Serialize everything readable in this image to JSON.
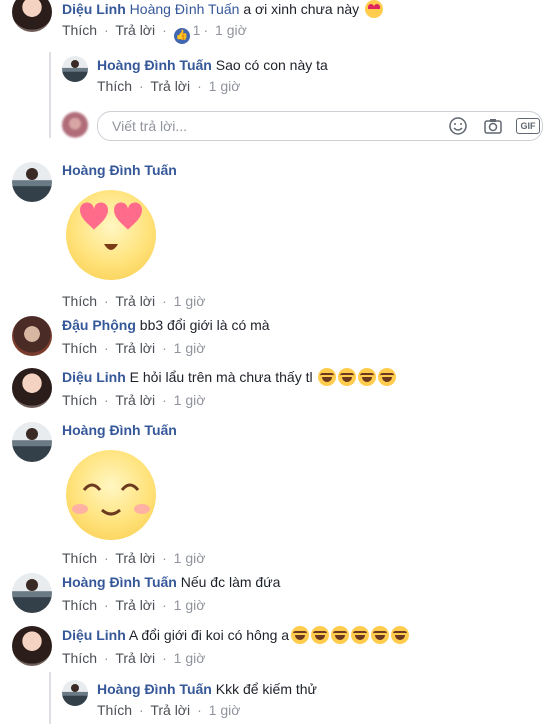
{
  "actions": {
    "like": "Thích",
    "reply": "Trả lời",
    "time": "1 giờ",
    "sep": "·"
  },
  "comments": [
    {
      "name": "Diệu Linh",
      "tag": "Hoàng Đình Tuấn",
      "text": "a ơi xinh chưa này",
      "likes": "1"
    },
    {
      "name": "Hoàng Đình Tuấn",
      "text": "Sao có con này ta"
    },
    {
      "name": "Hoàng Đình Tuấn",
      "sticker": "heart-eyes-sticker"
    },
    {
      "name": "Đậu Phộng",
      "text": "bb3 đổi giới là có mà"
    },
    {
      "name": "Diệu Linh",
      "text": "E hỏi lẩu trên mà chưa thấy tl"
    },
    {
      "name": "Hoàng Đình Tuấn",
      "sticker": "smiling-sticker"
    },
    {
      "name": "Hoàng Đình Tuấn",
      "text": "Nếu đc làm đứa"
    },
    {
      "name": "Diệu Linh",
      "text": "A đổi giới đi koi có hông a"
    },
    {
      "name": "Hoàng Đình Tuấn",
      "text": "Kkk để kiếm thử"
    }
  ],
  "reply_input": {
    "placeholder": "Viết trả lời..."
  },
  "icons": {
    "emoji": "smiley-icon",
    "camera": "camera-icon",
    "gif": "GIF"
  }
}
